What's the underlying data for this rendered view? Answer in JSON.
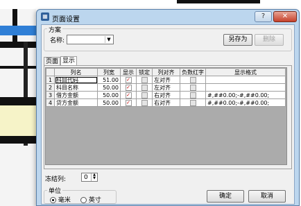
{
  "window": {
    "title": "页面设置",
    "help_label": "?",
    "close_label": "✕"
  },
  "scheme": {
    "group_label": "方案",
    "name_label": "名称:",
    "name_value": "",
    "save_as_label": "另存为",
    "delete_label": "删除"
  },
  "tabs": [
    {
      "label": "页面",
      "active": false
    },
    {
      "label": "显示",
      "active": true
    }
  ],
  "grid": {
    "columns": [
      "列名",
      "列宽",
      "显示",
      "锁定",
      "列对齐",
      "负数红字",
      "显示格式"
    ],
    "rows": [
      {
        "num": "1",
        "name": "科目代码",
        "width": "51.00",
        "display": true,
        "lock": false,
        "align": "左对齐",
        "neg_red": false,
        "format": ""
      },
      {
        "num": "2",
        "name": "科目名称",
        "width": "50.00",
        "display": true,
        "lock": false,
        "align": "左对齐",
        "neg_red": false,
        "format": ""
      },
      {
        "num": "3",
        "name": "借方金额",
        "width": "50.00",
        "display": true,
        "lock": false,
        "align": "右对齐",
        "neg_red": false,
        "format": "#,##0.00;-#,##0.00;"
      },
      {
        "num": "4",
        "name": "贷方金额",
        "width": "50.00",
        "display": true,
        "lock": false,
        "align": "右对齐",
        "neg_red": false,
        "format": "#,##0.00;-#,##0.00;"
      }
    ]
  },
  "freeze": {
    "label": "冻结列:",
    "value": "0"
  },
  "unit": {
    "group_label": "单位",
    "options": [
      {
        "label": "毫米",
        "selected": true
      },
      {
        "label": "英寸",
        "selected": false
      }
    ]
  },
  "buttons": {
    "ok_label": "确定",
    "cancel_label": "取消"
  },
  "colors": {
    "window_frame": "#bcd6ee",
    "close_button": "#c6402a",
    "check_mark": "#c00000"
  }
}
